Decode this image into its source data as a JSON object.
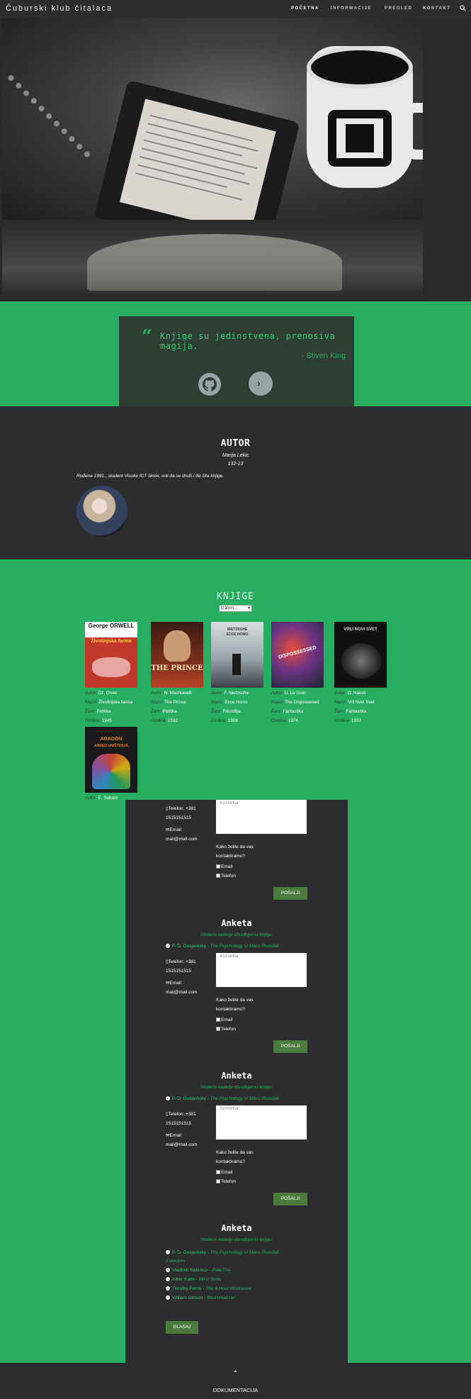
{
  "nav": {
    "brand": "Čuburski klub čitalaca",
    "links": [
      "POČETNA",
      "INFORMACIJE",
      "PREGLED",
      "KONTAKT"
    ],
    "search_icon": "search-icon"
  },
  "quote": {
    "text": "Knjige su jedinstvena, prenosiva magija.",
    "author": "- Stiven King"
  },
  "author": {
    "title": "AUTOR",
    "name": "Marija Lekic",
    "id": "132-13",
    "bio": "Rođena 1991., student Visoke ICT škole, voli da se druži i da čita knjige."
  },
  "books": {
    "title": "KNJIGE",
    "select_value": "Izaberi...",
    "labels": {
      "author": "Autor:",
      "title": "Naziv:",
      "genre": "Žanr:",
      "year": "Godina:"
    },
    "items": [
      {
        "author": "Dž. Orvel",
        "title": "Životinjska farma",
        "genre": "Politika",
        "year": "1945",
        "cover_top": "George ORWELL",
        "cover_sub": "Životinjska farma"
      },
      {
        "author": "N. Machiavelli",
        "title": "The Prince",
        "genre": "Politika",
        "year": "1532",
        "cover_top": "",
        "cover_sub": "THE PRINCE"
      },
      {
        "author": "F. Nietzsche",
        "title": "Ecce Homo",
        "genre": "Filozofija",
        "year": "1908",
        "cover_top": "NIETZSCHE",
        "cover_sub": "ECCE HOMO"
      },
      {
        "author": "U. Le Guin",
        "title": "The Dispossesed",
        "genre": "Fantastika",
        "year": "1974",
        "cover_top": "",
        "cover_sub": "DISPOSSESSED"
      },
      {
        "author": "O. Haksli",
        "title": "Vrli Novi Svet",
        "genre": "Fantastika",
        "year": "1932",
        "cover_top": "VRLI NOVI SVET",
        "cover_sub": ""
      },
      {
        "author": "E. Sabato",
        "title": "",
        "genre": "",
        "year": "",
        "cover_top": "ABADON",
        "cover_sub": "ANĐEO UNIŠTENJA"
      }
    ]
  },
  "contact": {
    "phone": "Telefon: +381 1515151515",
    "email_label": "Email:",
    "email": "mail@mail.com",
    "comment_placeholder": "Komentar",
    "how_contact": "Kako želite da vas kontaktiramo?",
    "opt_email": "Email",
    "opt_phone": "Telefon",
    "send": "POŠALJI"
  },
  "poll": {
    "title": "Anketa",
    "subtitle": "Sledeće nedelje obrađujemo knjigu:",
    "first_option": {
      "author": "P. D. Ouspensky",
      "title": "The Psychology of Mans Possible"
    },
    "options": [
      {
        "author": "P. D. Ouspensky",
        "title": "The Psychology of Mans Possible Evolution"
      },
      {
        "author": "Vladimir Nabokov",
        "title": "Pale Fire"
      },
      {
        "author": "Alber Kami",
        "title": "Mit o Sizifu"
      },
      {
        "author": "Timothy Ferris",
        "title": "The 4-Hour Workweek"
      },
      {
        "author": "William Gibson",
        "title": "Neuromancer"
      }
    ],
    "vote": "GLASAJ"
  },
  "footer": {
    "up_icon": "chevron-up-icon",
    "doc": "DOKUMENTACIJA"
  }
}
